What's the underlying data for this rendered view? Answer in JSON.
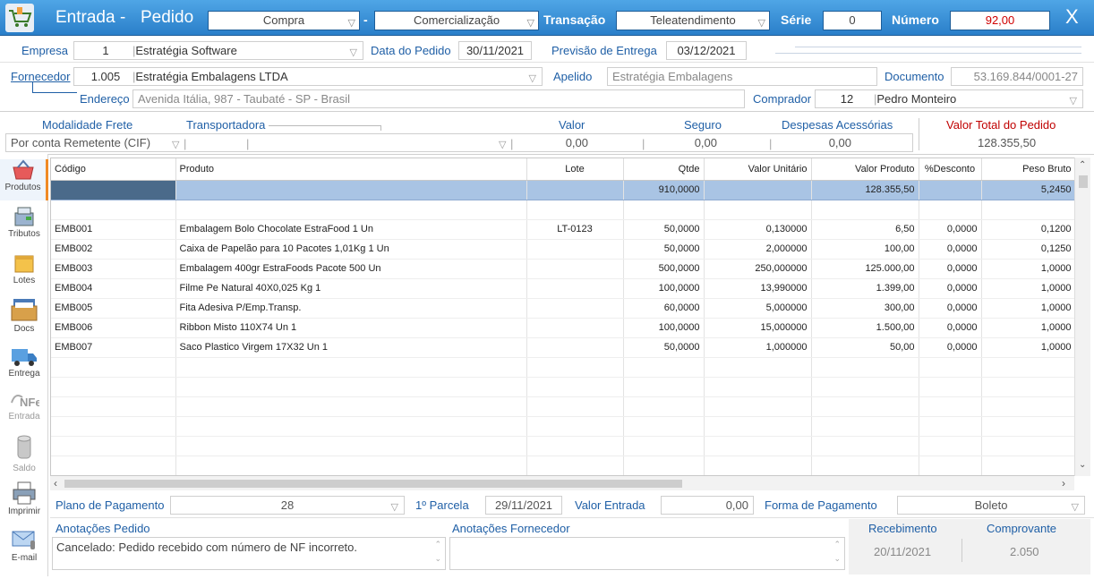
{
  "title": {
    "heading": "Entrada",
    "dash": "-",
    "subheading": "Pedido",
    "compra": "Compra",
    "dash2": "-",
    "comercializacao": "Comercialização",
    "transacao_label": "Transação",
    "transacao_value": "Teleatendimento",
    "serie_label": "Série",
    "serie_value": "0",
    "numero_label": "Número",
    "numero_value": "92,00",
    "close": "X"
  },
  "header": {
    "empresa_label": "Empresa",
    "empresa_code": "1",
    "empresa_name": "Estratégia Software",
    "data_pedido_label": "Data do Pedido",
    "data_pedido": "30/11/2021",
    "previsao_label": "Previsão de Entrega",
    "previsao": "03/12/2021",
    "fornecedor_label": "Fornecedor",
    "fornecedor_code": "1.005",
    "fornecedor_name": "Estratégia Embalagens LTDA",
    "apelido_label": "Apelido",
    "apelido": "Estratégia Embalagens",
    "documento_label": "Documento",
    "documento": "53.169.844/0001-27",
    "endereco_label": "Endereço",
    "endereco": "Avenida Itália, 987 - Taubaté - SP - Brasil",
    "comprador_label": "Comprador",
    "comprador_code": "12",
    "comprador_name": "Pedro Monteiro"
  },
  "frete": {
    "modalidade_label": "Modalidade Frete",
    "modalidade": "Por conta Remetente (CIF)",
    "transportadora_label": "Transportadora",
    "valor_label": "Valor",
    "valor": "0,00",
    "seguro_label": "Seguro",
    "seguro": "0,00",
    "despesas_label": "Despesas Acessórias",
    "despesas": "0,00",
    "total_label": "Valor Total do Pedido",
    "total": "128.355,50"
  },
  "sidebar": {
    "produtos": "Produtos",
    "tributos": "Tributos",
    "lotes": "Lotes",
    "docs": "Docs",
    "entrega": "Entrega",
    "entrada": "Entrada",
    "saldo": "Saldo",
    "imprimir": "Imprimir",
    "email": "E-mail"
  },
  "grid": {
    "columns": [
      "Código",
      "Produto",
      "Lote",
      "Qtde",
      "Valor Unitário",
      "Valor Produto",
      "%Desconto",
      "Peso Bruto"
    ],
    "totals": {
      "qtde": "910,0000",
      "valor_produto": "128.355,50",
      "peso": "5,2450"
    },
    "rows": [
      {
        "codigo": "EMB001",
        "produto": "Embalagem Bolo Chocolate EstraFood 1 Un",
        "lote": "LT-0123",
        "qtde": "50,0000",
        "unit": "0,130000",
        "valor": "6,50",
        "desc": "0,0000",
        "peso": "0,1200"
      },
      {
        "codigo": "EMB002",
        "produto": "Caixa de Papelão para 10 Pacotes 1,01Kg 1 Un",
        "lote": "",
        "qtde": "50,0000",
        "unit": "2,000000",
        "valor": "100,00",
        "desc": "0,0000",
        "peso": "0,1250"
      },
      {
        "codigo": "EMB003",
        "produto": "Embalagem 400gr EstraFoods Pacote 500 Un",
        "lote": "",
        "qtde": "500,0000",
        "unit": "250,000000",
        "valor": "125.000,00",
        "desc": "0,0000",
        "peso": "1,0000"
      },
      {
        "codigo": "EMB004",
        "produto": "Filme Pe Natural 40X0,025 Kg 1",
        "lote": "",
        "qtde": "100,0000",
        "unit": "13,990000",
        "valor": "1.399,00",
        "desc": "0,0000",
        "peso": "1,0000"
      },
      {
        "codigo": "EMB005",
        "produto": "Fita Adesiva P/Emp.Transp.",
        "lote": "",
        "qtde": "60,0000",
        "unit": "5,000000",
        "valor": "300,00",
        "desc": "0,0000",
        "peso": "1,0000"
      },
      {
        "codigo": "EMB006",
        "produto": "Ribbon Misto 110X74 Un 1",
        "lote": "",
        "qtde": "100,0000",
        "unit": "15,000000",
        "valor": "1.500,00",
        "desc": "0,0000",
        "peso": "1,0000"
      },
      {
        "codigo": "EMB007",
        "produto": "Saco Plastico Virgem 17X32 Un 1",
        "lote": "",
        "qtde": "50,0000",
        "unit": "1,000000",
        "valor": "50,00",
        "desc": "0,0000",
        "peso": "1,0000"
      }
    ]
  },
  "pagamento": {
    "plano_label": "Plano de Pagamento",
    "plano": "28",
    "parcela_label": "1º Parcela",
    "parcela": "29/11/2021",
    "valor_entrada_label": "Valor Entrada",
    "valor_entrada": "0,00",
    "forma_label": "Forma de Pagamento",
    "forma": "Boleto"
  },
  "anotacoes": {
    "pedido_label": "Anotações Pedido",
    "pedido": "Cancelado: Pedido recebido com número de NF incorreto.",
    "fornecedor_label": "Anotações Fornecedor",
    "fornecedor": "",
    "recebimento_label": "Recebimento",
    "recebimento": "20/11/2021",
    "comprovante_label": "Comprovante",
    "comprovante": "2.050"
  },
  "colors": {
    "title_bar": "#2a7fc9",
    "label_blue": "#1f5fa6",
    "total_red": "#c00000",
    "totals_row": "#a9c4e4"
  }
}
